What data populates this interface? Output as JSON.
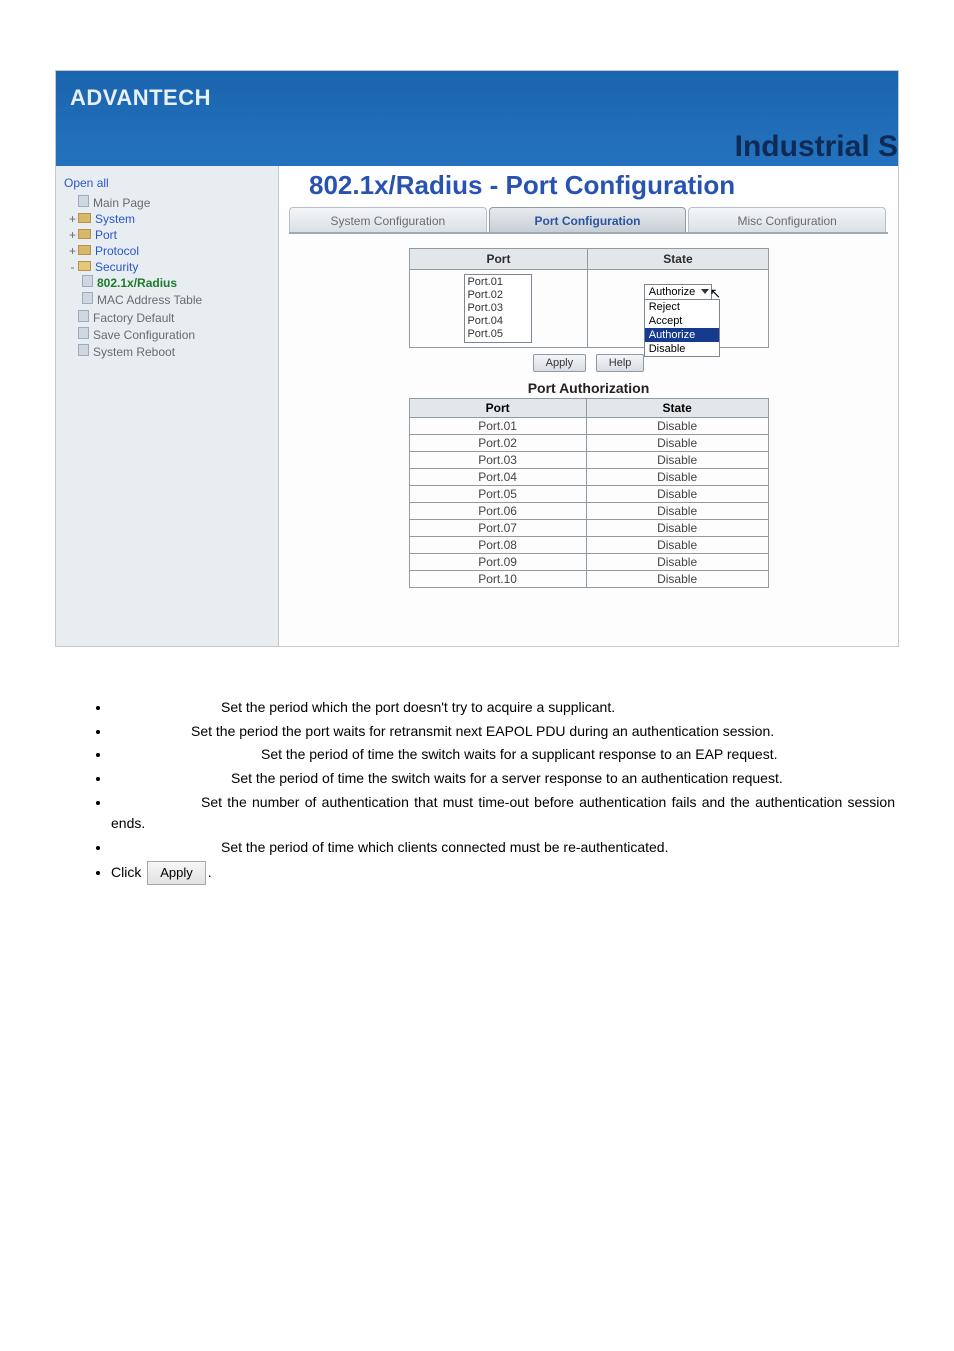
{
  "brand": "ADVANTECH",
  "banner_suffix": "Industrial S",
  "page_title": "802.1x/Radius - Port Configuration",
  "sidebar": {
    "open_all": "Open all",
    "items": [
      {
        "label": "Main Page",
        "kind": "page"
      },
      {
        "label": "System",
        "kind": "folder",
        "toggle": "+"
      },
      {
        "label": "Port",
        "kind": "folder",
        "toggle": "+"
      },
      {
        "label": "Protocol",
        "kind": "folder",
        "toggle": "+"
      },
      {
        "label": "Security",
        "kind": "folder-open",
        "toggle": "-",
        "children": [
          {
            "label": "802.1x/Radius",
            "kind": "page"
          },
          {
            "label": "MAC Address Table",
            "kind": "page"
          }
        ]
      },
      {
        "label": "Factory Default",
        "kind": "page"
      },
      {
        "label": "Save Configuration",
        "kind": "page"
      },
      {
        "label": "System Reboot",
        "kind": "page"
      }
    ]
  },
  "tabs": [
    {
      "label": "System Configuration",
      "active": false
    },
    {
      "label": "Port Configuration",
      "active": true
    },
    {
      "label": "Misc Configuration",
      "active": false
    }
  ],
  "cfg": {
    "col_port": "Port",
    "col_state": "State",
    "port_options": [
      "Port.01",
      "Port.02",
      "Port.03",
      "Port.04",
      "Port.05"
    ],
    "state_value": "Authorize",
    "state_options": [
      "Reject",
      "Accept",
      "Authorize",
      "Disable"
    ]
  },
  "buttons": {
    "apply": "Apply",
    "help": "Help"
  },
  "pa": {
    "title": "Port Authorization",
    "col_port": "Port",
    "col_state": "State",
    "rows": [
      {
        "port": "Port.01",
        "state": "Disable"
      },
      {
        "port": "Port.02",
        "state": "Disable"
      },
      {
        "port": "Port.03",
        "state": "Disable"
      },
      {
        "port": "Port.04",
        "state": "Disable"
      },
      {
        "port": "Port.05",
        "state": "Disable"
      },
      {
        "port": "Port.06",
        "state": "Disable"
      },
      {
        "port": "Port.07",
        "state": "Disable"
      },
      {
        "port": "Port.08",
        "state": "Disable"
      },
      {
        "port": "Port.09",
        "state": "Disable"
      },
      {
        "port": "Port.10",
        "state": "Disable"
      }
    ]
  },
  "doc": {
    "b1": "Set the period which the port doesn't try to acquire a supplicant.",
    "b2": "Set the period the port waits for retransmit next EAPOL PDU during an authentication session.",
    "b3": "Set the period of time the switch waits for a supplicant response to an EAP request.",
    "b4": "Set the period of time the switch waits for a server response to an authentication request.",
    "b5": "Set the number of authentication that must time-out before authentication fails and the authentication session ends.",
    "b6": "Set the period of time which clients connected must be re-authenticated.",
    "b7a": "Click",
    "b7btn": "Apply",
    "b7b": "."
  }
}
